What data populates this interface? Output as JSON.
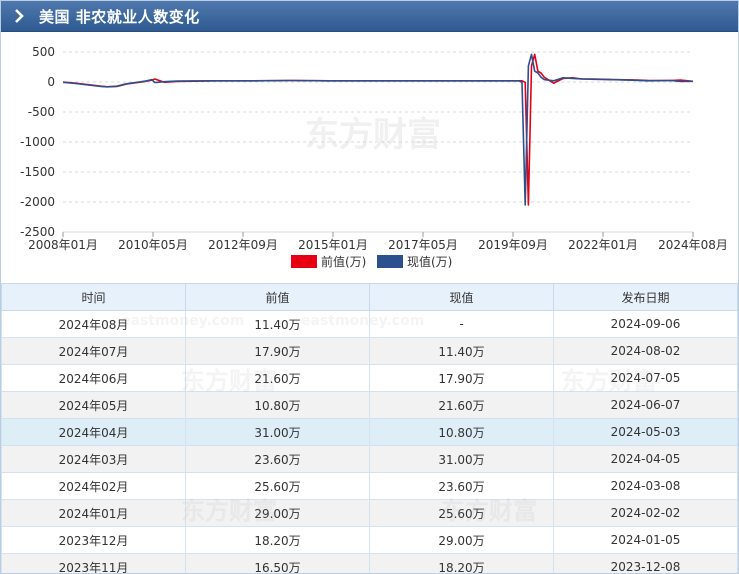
{
  "header": {
    "title": "美国 非农就业人数变化",
    "icon": "chevron-right-icon"
  },
  "watermark": {
    "text": "东方财富",
    "url_text": "eastmoney.com"
  },
  "chart_data": {
    "type": "line",
    "title": "",
    "xlabel": "",
    "ylabel": "",
    "ylim": [
      -2500,
      500
    ],
    "yticks": [
      500,
      0,
      -500,
      -1000,
      -1500,
      -2000,
      -2500
    ],
    "xtick_labels": [
      "2008年01月",
      "2010年05月",
      "2012年09月",
      "2015年01月",
      "2017年05月",
      "2019年09月",
      "2022年01月",
      "2024年08月"
    ],
    "grid": true,
    "legend": "bottom-center",
    "x": [
      "2008-01",
      "2008-05",
      "2008-09",
      "2009-01",
      "2009-03",
      "2009-06",
      "2009-09",
      "2010-01",
      "2010-03",
      "2010-05",
      "2010-06",
      "2010-09",
      "2011-01",
      "2012-01",
      "2013-01",
      "2014-01",
      "2015-01",
      "2016-01",
      "2017-01",
      "2018-01",
      "2019-01",
      "2019-06",
      "2020-01",
      "2020-02",
      "2020-03",
      "2020-04",
      "2020-05",
      "2020-06",
      "2020-07",
      "2020-08",
      "2020-09",
      "2020-12",
      "2021-03",
      "2021-06",
      "2021-09",
      "2022-01",
      "2022-06",
      "2023-01",
      "2023-06",
      "2024-01",
      "2024-04",
      "2024-08"
    ],
    "series": [
      {
        "name": "前值(万)",
        "color": "#e60012",
        "values": [
          -2,
          -20,
          -45,
          -70,
          -80,
          -75,
          -35,
          -5,
          10,
          30,
          50,
          -5,
          10,
          20,
          20,
          25,
          20,
          20,
          20,
          20,
          20,
          20,
          20,
          20,
          -5,
          -2050,
          270,
          460,
          180,
          150,
          80,
          -20,
          60,
          70,
          50,
          50,
          40,
          35,
          25,
          25,
          31,
          11.4
        ]
      },
      {
        "name": "现值(万)",
        "color": "#2c4f8e",
        "values": [
          -5,
          -25,
          -50,
          -75,
          -80,
          -70,
          -30,
          0,
          15,
          40,
          -10,
          5,
          15,
          20,
          20,
          25,
          20,
          20,
          20,
          20,
          20,
          20,
          20,
          -5,
          -2050,
          270,
          460,
          180,
          150,
          80,
          40,
          20,
          70,
          60,
          50,
          45,
          40,
          30,
          20,
          25,
          10.8,
          11.4
        ]
      }
    ]
  },
  "table": {
    "headers": [
      "时间",
      "前值",
      "现值",
      "发布日期"
    ],
    "rows": [
      [
        "2024年08月",
        "11.40万",
        "-",
        "2024-09-06"
      ],
      [
        "2024年07月",
        "17.90万",
        "11.40万",
        "2024-08-02"
      ],
      [
        "2024年06月",
        "21.60万",
        "17.90万",
        "2024-07-05"
      ],
      [
        "2024年05月",
        "10.80万",
        "21.60万",
        "2024-06-07"
      ],
      [
        "2024年04月",
        "31.00万",
        "10.80万",
        "2024-05-03"
      ],
      [
        "2024年03月",
        "23.60万",
        "31.00万",
        "2024-04-05"
      ],
      [
        "2024年02月",
        "25.60万",
        "23.60万",
        "2024-03-08"
      ],
      [
        "2024年01月",
        "29.00万",
        "25.60万",
        "2024-02-02"
      ],
      [
        "2023年12月",
        "18.20万",
        "29.00万",
        "2024-01-05"
      ],
      [
        "2023年11月",
        "16.50万",
        "18.20万",
        "2023-12-08"
      ]
    ],
    "highlight_row": 4
  }
}
